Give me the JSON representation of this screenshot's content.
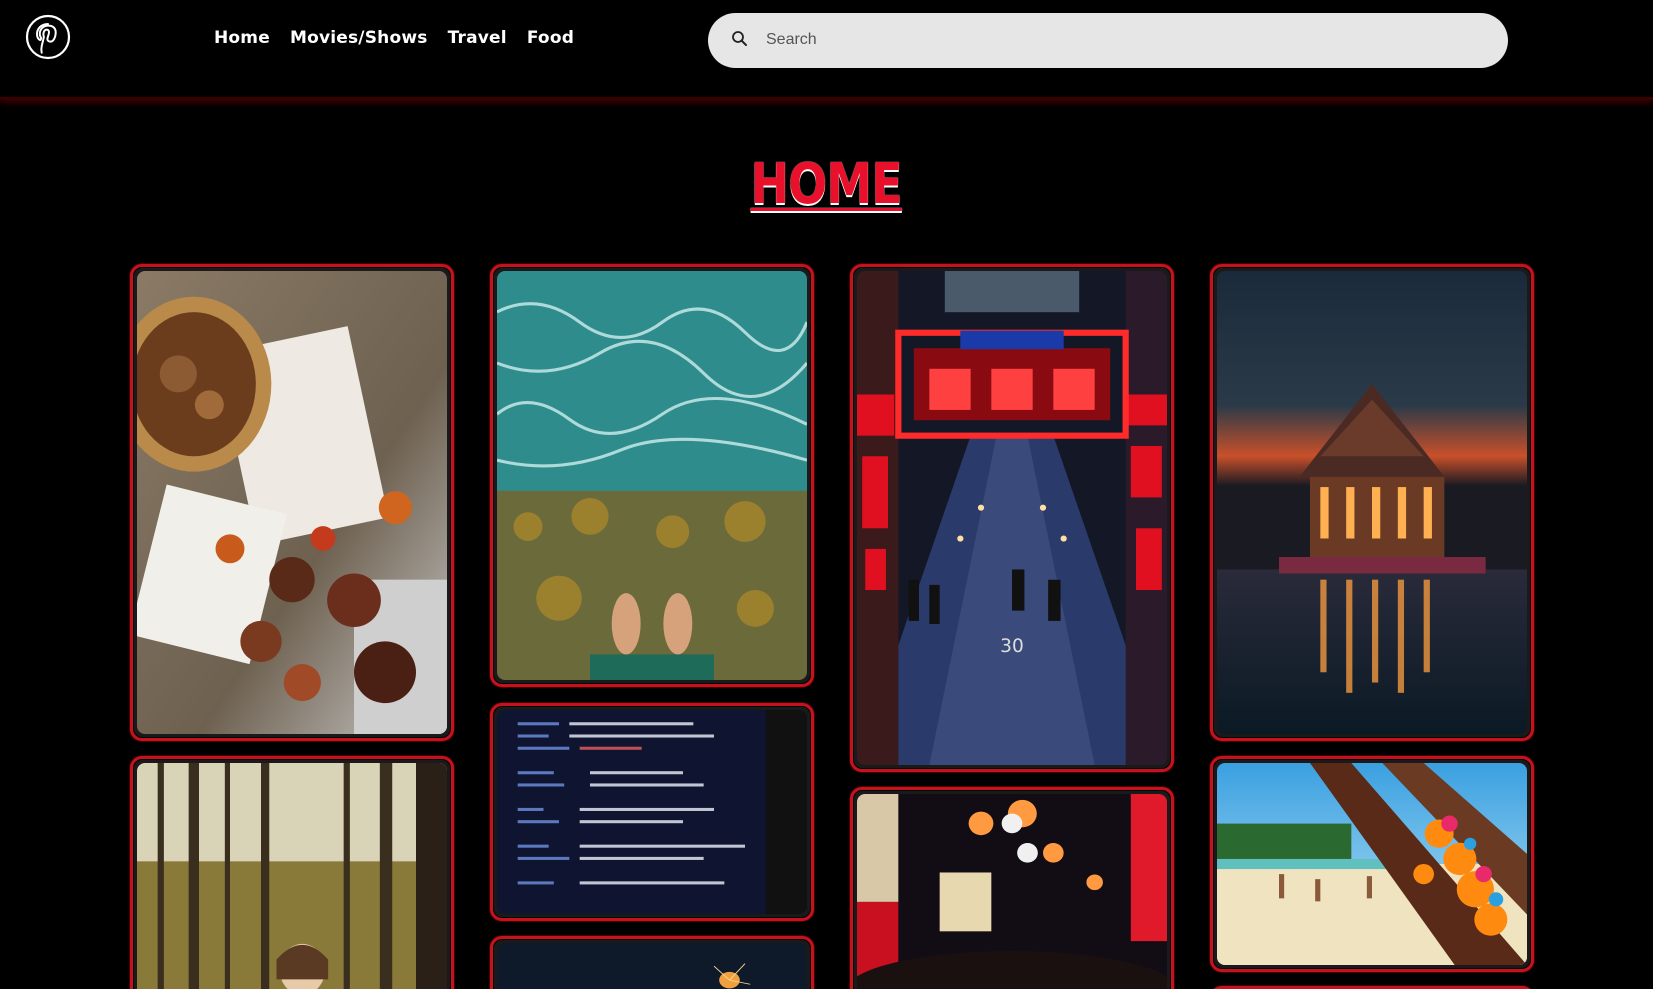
{
  "header": {
    "logo": "pinterest-logo",
    "nav": [
      "Home",
      "Movies/Shows",
      "Travel",
      "Food"
    ],
    "search": {
      "placeholder": "Search",
      "value": "",
      "icon": "search-icon"
    }
  },
  "page": {
    "title": "HOME"
  },
  "colors": {
    "accent": "#e8102a",
    "card_border": "#c4121f",
    "background": "#000000",
    "search_bg": "#e6e6e6"
  }
}
